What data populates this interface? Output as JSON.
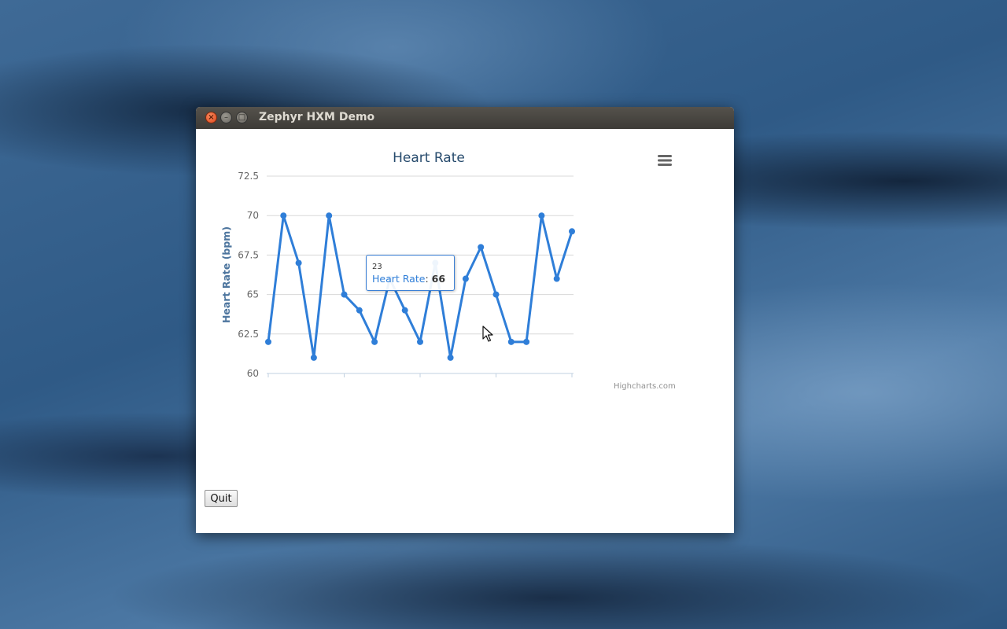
{
  "window": {
    "title": "Zephyr HXM Demo",
    "close_glyph": "×",
    "min_glyph": "–",
    "max_glyph": "□"
  },
  "chart": {
    "credits": "Highcharts.com",
    "series_color": "#2f7ed8",
    "menu_icon": "menu-icon",
    "tooltip": {
      "x_label": "23",
      "series_name": "Heart Rate",
      "separator": ": ",
      "value": "66"
    }
  },
  "chart_data": {
    "type": "line",
    "title": "Heart Rate",
    "ylabel": "Heart Rate (bpm)",
    "xlabel": "",
    "ylim": [
      60,
      72.5
    ],
    "yticks": [
      "60",
      "62.5",
      "65",
      "67.5",
      "70",
      "72.5"
    ],
    "grid": true,
    "series": [
      {
        "name": "Heart Rate",
        "values": [
          62,
          70,
          67,
          61,
          70,
          65,
          64,
          62,
          66,
          64,
          62,
          67,
          61,
          66,
          68,
          65,
          62,
          62,
          70,
          66,
          69
        ]
      }
    ]
  },
  "buttons": {
    "quit_label": "Quit"
  }
}
